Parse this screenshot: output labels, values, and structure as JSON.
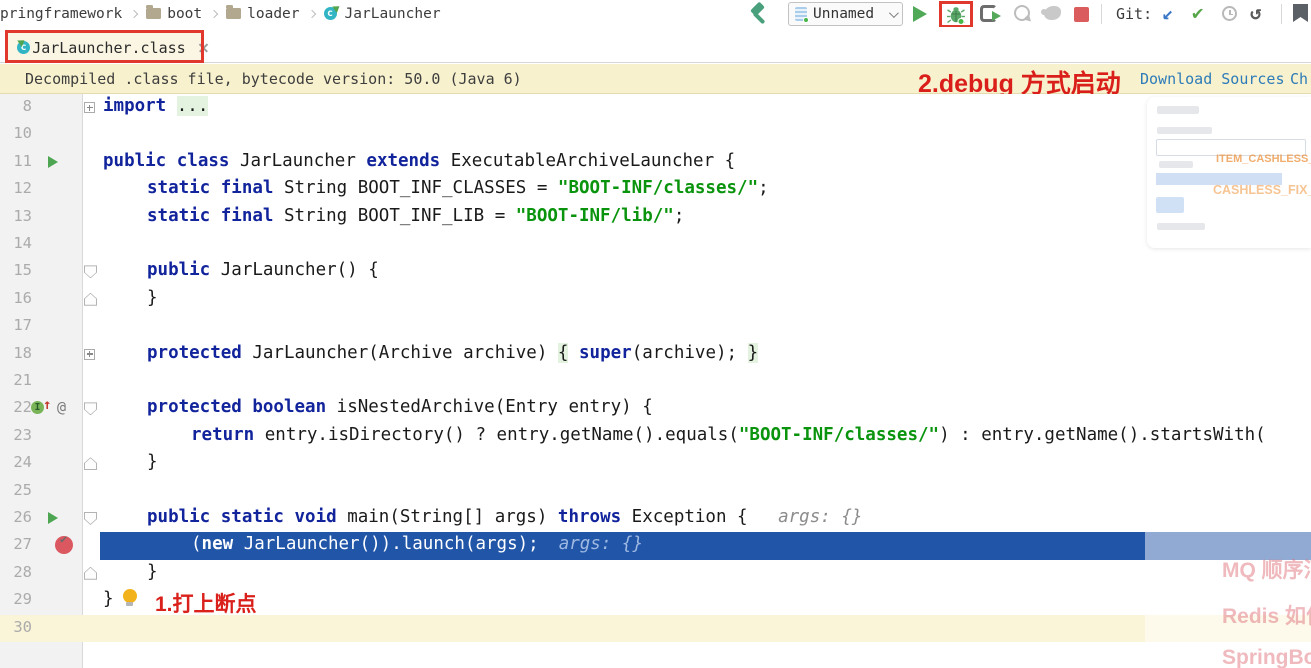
{
  "breadcrumb": {
    "items": [
      {
        "label": "pringframework",
        "icon": null
      },
      {
        "label": "boot",
        "icon": "folder"
      },
      {
        "label": "loader",
        "icon": "folder"
      },
      {
        "label": "JarLauncher",
        "icon": "class"
      }
    ]
  },
  "toolbar": {
    "run_config_label": "Unnamed",
    "git_label": "Git:"
  },
  "tab": {
    "title": "JarLauncher.class"
  },
  "notification": {
    "message": "Decompiled .class file, bytecode version: 50.0 (Java 6)",
    "debug_note": "2.debug 方式启动",
    "link1": "Download Sources",
    "link2": "Ch"
  },
  "icons": {
    "check": "✔",
    "update_arrow": "↙",
    "undo_arrow": "↺",
    "at": "@",
    "impl": "I",
    "up_arrow": "↑",
    "class_letter": "c"
  },
  "editor": {
    "breakpoint_note": "1.打上断点",
    "lines": [
      {
        "n": "8",
        "fold": "plus",
        "ind": 0,
        "seg": [
          [
            "k",
            "import"
          ],
          [
            "p",
            " "
          ],
          [
            "f",
            "..."
          ]
        ]
      },
      {
        "n": "10"
      },
      {
        "n": "11",
        "icons": [
          "run"
        ],
        "ind": 0,
        "seg": [
          [
            "k",
            "public class"
          ],
          [
            "p",
            " JarLauncher "
          ],
          [
            "k",
            "extends"
          ],
          [
            "p",
            " ExecutableArchiveLauncher {"
          ]
        ]
      },
      {
        "n": "12",
        "ind": 1,
        "seg": [
          [
            "k",
            "static final"
          ],
          [
            "p",
            " String BOOT_INF_CLASSES = "
          ],
          [
            "s",
            "\"BOOT-INF/classes/\""
          ],
          [
            "p",
            ";"
          ]
        ]
      },
      {
        "n": "13",
        "ind": 1,
        "seg": [
          [
            "k",
            "static final"
          ],
          [
            "p",
            " String BOOT_INF_LIB = "
          ],
          [
            "s",
            "\"BOOT-INF/lib/\""
          ],
          [
            "p",
            ";"
          ]
        ]
      },
      {
        "n": "14"
      },
      {
        "n": "15",
        "fold": "down",
        "ind": 1,
        "seg": [
          [
            "k",
            "public"
          ],
          [
            "p",
            " JarLauncher() {"
          ]
        ]
      },
      {
        "n": "16",
        "fold": "up",
        "ind": 1,
        "seg": [
          [
            "p",
            "}"
          ]
        ]
      },
      {
        "n": "17"
      },
      {
        "n": "18",
        "fold": "plus",
        "ind": 1,
        "seg": [
          [
            "k",
            "protected"
          ],
          [
            "p",
            " JarLauncher(Archive archive) "
          ],
          [
            "f",
            "{"
          ],
          [
            "p",
            " "
          ],
          [
            "k",
            "super"
          ],
          [
            "p",
            "(archive); "
          ],
          [
            "f",
            "}"
          ]
        ]
      },
      {
        "n": "21"
      },
      {
        "n": "22",
        "icons": [
          "override"
        ],
        "fold": "down",
        "ind": 1,
        "seg": [
          [
            "k",
            "protected boolean"
          ],
          [
            "p",
            " isNestedArchive(Entry entry) {"
          ]
        ]
      },
      {
        "n": "23",
        "ind": 2,
        "seg": [
          [
            "k",
            "return"
          ],
          [
            "p",
            " entry.isDirectory() ? entry.getName().equals("
          ],
          [
            "s",
            "\"BOOT-INF/classes/\""
          ],
          [
            "p",
            ") : entry.getName().startsWith("
          ]
        ]
      },
      {
        "n": "24",
        "fold": "up",
        "ind": 1,
        "seg": [
          [
            "p",
            "}"
          ]
        ]
      },
      {
        "n": "25"
      },
      {
        "n": "26",
        "icons": [
          "run"
        ],
        "fold": "down",
        "ind": 1,
        "hint": "args: {}",
        "seg": [
          [
            "k",
            "public static void"
          ],
          [
            "p",
            " main(String[] args) "
          ],
          [
            "k",
            "throws"
          ],
          [
            "p",
            " Exception { "
          ]
        ]
      },
      {
        "n": "27",
        "icons": [
          "bp"
        ],
        "exec": true,
        "ind": 2,
        "hint": "args: {}",
        "seg": [
          [
            "p",
            "("
          ],
          [
            "k",
            "new"
          ],
          [
            "p",
            " JarLauncher()).launch(args);"
          ]
        ]
      },
      {
        "n": "28",
        "fold": "up",
        "ind": 1,
        "seg": [
          [
            "p",
            "}"
          ]
        ]
      },
      {
        "n": "29",
        "ind": 0,
        "bulb": true,
        "note": true,
        "seg": [
          [
            "p",
            "}"
          ]
        ]
      },
      {
        "n": "30",
        "band": true
      }
    ]
  },
  "ghost": {
    "texts": [
      "ITEM_CASHLESS_FI",
      "CASHLESS_FIX_VO"
    ]
  },
  "watermarks": {
    "items": [
      "MQ 顺序消",
      "Redis 如何",
      "SpringBoo"
    ]
  },
  "colors": {
    "execution_line": "#2055a8",
    "notification_bg": "#f7f1ce",
    "annotation_red": "#da1f1a",
    "keyword": "#12249c",
    "string": "#0a940d",
    "tab_underline": "#3574f0"
  }
}
